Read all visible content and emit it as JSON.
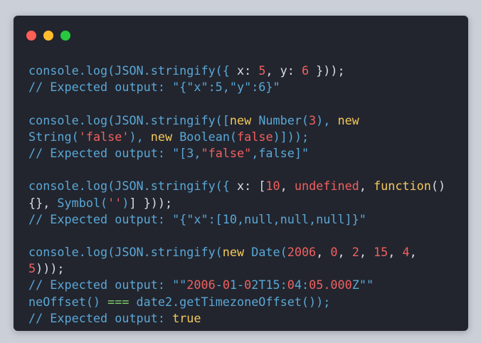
{
  "window": {
    "controls": [
      {
        "name": "close",
        "color": "#ff5f56"
      },
      {
        "name": "minimize",
        "color": "#ffbd2e"
      },
      {
        "name": "maximize",
        "color": "#27c93f"
      }
    ]
  },
  "code_lines": [
    [
      [
        "fn",
        "console.log(JSON.stringify({ "
      ],
      [
        "pl",
        "x: "
      ],
      [
        "num",
        "5"
      ],
      [
        "pl",
        ", y: "
      ],
      [
        "num",
        "6"
      ],
      [
        "pl",
        " }));"
      ]
    ],
    [
      [
        "cm",
        "// Expected output: \"{\"x\":5,\"y\":6}\""
      ]
    ],
    [],
    [
      [
        "fn",
        "console.log(JSON.stringify(["
      ],
      [
        "kw",
        "new "
      ],
      [
        "fn",
        "Number("
      ],
      [
        "num",
        "3"
      ],
      [
        "fn",
        "), "
      ],
      [
        "kw",
        "new"
      ]
    ],
    [
      [
        "fn",
        "String("
      ],
      [
        "str",
        "'false'"
      ],
      [
        "fn",
        "), "
      ],
      [
        "kw",
        "new "
      ],
      [
        "fn",
        "Boolean("
      ],
      [
        "str",
        "false"
      ],
      [
        "fn",
        ")]));"
      ]
    ],
    [
      [
        "cm",
        "// Expected output: \"[3,"
      ],
      [
        "str",
        "\"false\""
      ],
      [
        "cm",
        ",false]\""
      ]
    ],
    [],
    [
      [
        "fn",
        "console.log(JSON.stringify({ "
      ],
      [
        "pl",
        "x: ["
      ],
      [
        "num",
        "10"
      ],
      [
        "pl",
        ", "
      ],
      [
        "str",
        "undefined"
      ],
      [
        "pl",
        ", "
      ],
      [
        "kw",
        "function"
      ],
      [
        "pl",
        "()"
      ]
    ],
    [
      [
        "pl",
        "{}, "
      ],
      [
        "fn",
        "Symbol("
      ],
      [
        "str",
        "''"
      ],
      [
        "fn",
        ")"
      ],
      [
        "pl",
        "] }));"
      ]
    ],
    [
      [
        "cm",
        "// Expected output: \"{\"x\":[10,null,null,null]}\""
      ]
    ],
    [],
    [
      [
        "fn",
        "console.log(JSON.stringify("
      ],
      [
        "kw",
        "new "
      ],
      [
        "fn",
        "Date("
      ],
      [
        "num",
        "2006"
      ],
      [
        "pl",
        ", "
      ],
      [
        "num",
        "0"
      ],
      [
        "pl",
        ", "
      ],
      [
        "num",
        "2"
      ],
      [
        "pl",
        ", "
      ],
      [
        "num",
        "15"
      ],
      [
        "pl",
        ", "
      ],
      [
        "num",
        "4"
      ],
      [
        "pl",
        ","
      ]
    ],
    [
      [
        "num",
        "5"
      ],
      [
        "pl",
        ")));"
      ]
    ],
    [
      [
        "cm",
        "// Expected output: \"\""
      ],
      [
        "str",
        "2006"
      ],
      [
        "cm",
        "-"
      ],
      [
        "str",
        "0"
      ],
      [
        "cm",
        "1-"
      ],
      [
        "str",
        "0"
      ],
      [
        "cm",
        "2T15:"
      ],
      [
        "str",
        "0"
      ],
      [
        "cm",
        "4:"
      ],
      [
        "str",
        "05.000"
      ],
      [
        "cm",
        "Z\"\""
      ]
    ],
    [
      [
        "fn",
        "neOffset() "
      ],
      [
        "gr",
        "==="
      ],
      [
        "fn",
        " date2.getTimezoneOffset());"
      ]
    ],
    [
      [
        "cm",
        "// Expected output: "
      ],
      [
        "kw",
        "true"
      ]
    ]
  ]
}
